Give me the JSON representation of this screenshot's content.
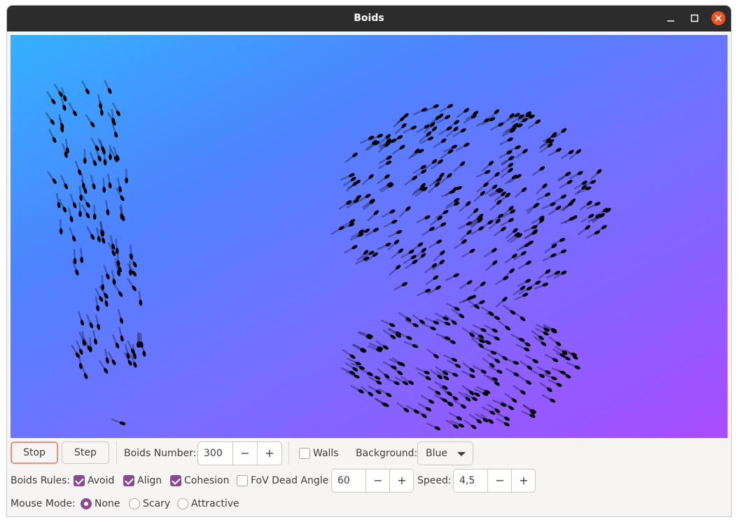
{
  "window": {
    "title": "Boids"
  },
  "controls": {
    "stop_label": "Stop",
    "step_label": "Step",
    "boids_number_label": "Boids Number:",
    "boids_number_value": "300",
    "walls_label": "Walls",
    "walls_checked": false,
    "background_label": "Background:",
    "background_value": "Blue",
    "rules_label": "Boids Rules:",
    "avoid_label": "Avoid",
    "avoid_checked": true,
    "align_label": "Align",
    "align_checked": true,
    "cohesion_label": "Cohesion",
    "cohesion_checked": true,
    "fov_label": "FoV Dead Angle",
    "fov_checked": false,
    "fov_value": "60",
    "speed_label": "Speed:",
    "speed_value": "4,5",
    "mouse_mode_label": "Mouse Mode:",
    "mouse_none_label": "None",
    "mouse_scary_label": "Scary",
    "mouse_attractive_label": "Attractive",
    "mouse_mode_selected": "None",
    "minus_glyph": "−",
    "plus_glyph": "+"
  },
  "colors": {
    "accent": "#8b4a8f",
    "stop_border": "#e8907d",
    "titlebar": "#2c2c2c",
    "close_button": "#e95420",
    "boid": "#000000",
    "background_gradient": [
      "#34b1ff",
      "#4e82ff",
      "#7072ff",
      "#a94cff"
    ]
  },
  "icons": {
    "minimize": "window-minimize-icon",
    "maximize": "window-maximize-icon",
    "close": "window-close-icon",
    "dropdown": "chevron-down-icon"
  }
}
